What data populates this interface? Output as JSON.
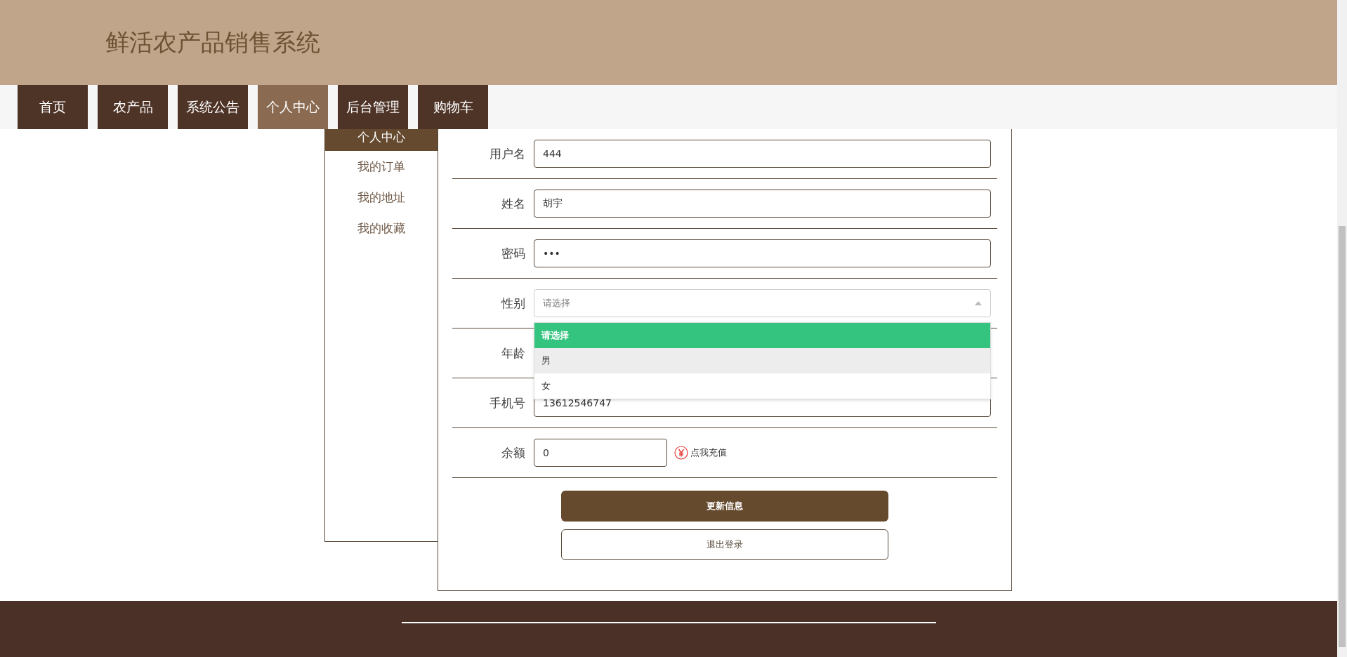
{
  "header": {
    "title": "鲜活农产品销售系统"
  },
  "nav": [
    {
      "label": "首页",
      "selected": false
    },
    {
      "label": "农产品",
      "selected": false
    },
    {
      "label": "系统公告",
      "selected": false
    },
    {
      "label": "个人中心",
      "selected": true
    },
    {
      "label": "后台管理",
      "selected": false
    },
    {
      "label": "购物车",
      "selected": false
    }
  ],
  "sidebar": [
    {
      "label": "个人中心",
      "selected": true
    },
    {
      "label": "我的订单",
      "selected": false
    },
    {
      "label": "我的地址",
      "selected": false
    },
    {
      "label": "我的收藏",
      "selected": false
    }
  ],
  "form": {
    "fields": [
      {
        "label": "用户名",
        "kind": "text",
        "value": "444"
      },
      {
        "label": "姓名",
        "kind": "text",
        "value": "胡宇"
      },
      {
        "label": "密码",
        "kind": "text",
        "value": "•••"
      },
      {
        "label": "性别",
        "kind": "select",
        "placeholder": "请选择",
        "expanded": true,
        "options": [
          {
            "label": "请选择",
            "selected": true,
            "hovered": false
          },
          {
            "label": "男",
            "selected": false,
            "hovered": true
          },
          {
            "label": "女",
            "selected": false,
            "hovered": false
          }
        ]
      },
      {
        "label": "年龄",
        "kind": "text"
      },
      {
        "label": "手机号",
        "kind": "text",
        "value": "13612546747"
      },
      {
        "label": "余额",
        "kind": "balance",
        "value": "0",
        "link": "点我充值"
      }
    ],
    "buttons": [
      {
        "label": "更新信息",
        "kind": "primary"
      },
      {
        "label": "退出登录",
        "kind": "secondary"
      }
    ]
  }
}
